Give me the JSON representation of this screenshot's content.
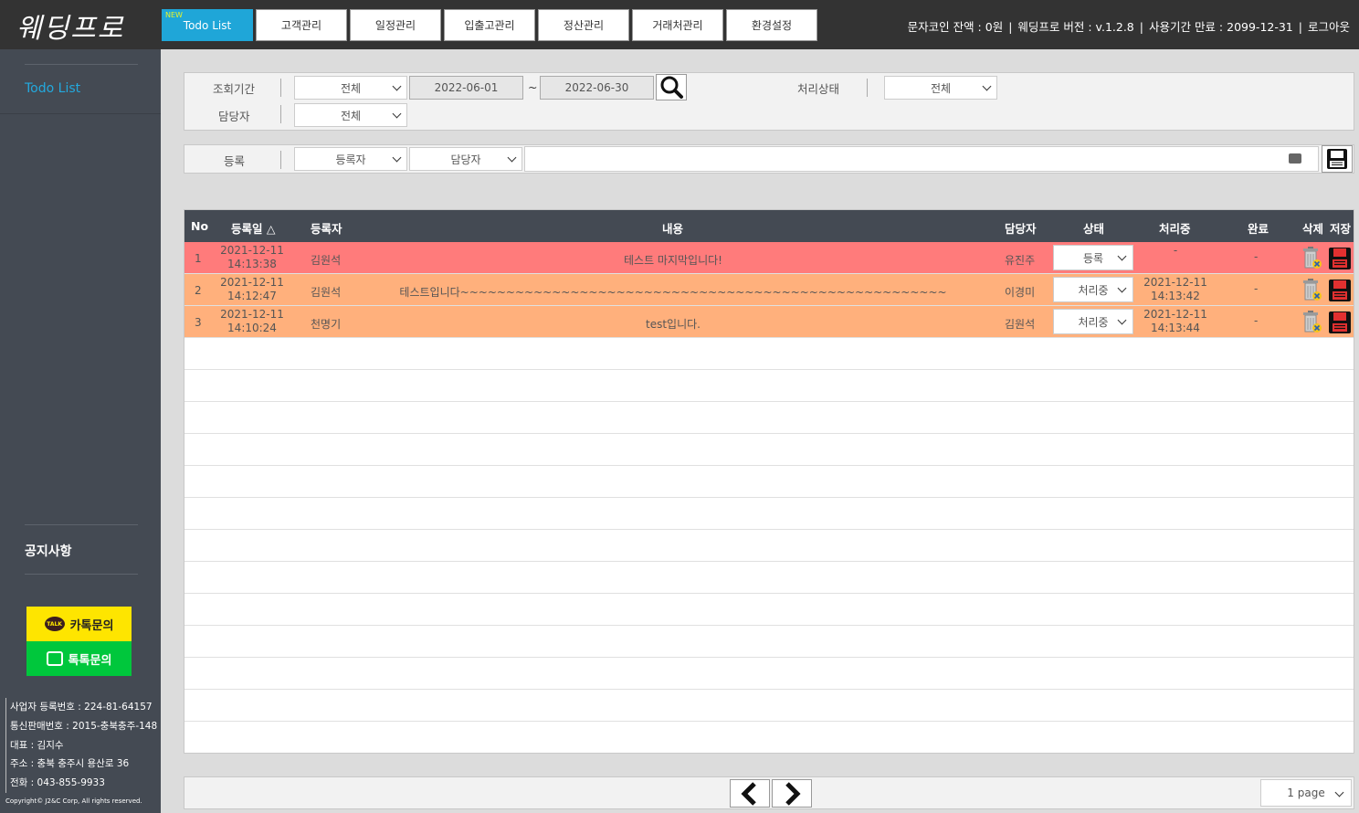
{
  "app": {
    "logo": "웨딩프로"
  },
  "nav": {
    "new_tag": "NEW",
    "tabs": [
      "Todo List",
      "고객관리",
      "일정관리",
      "입출고관리",
      "정산관리",
      "거래처관리",
      "환경설정"
    ]
  },
  "topinfo": {
    "coin": "문자코인 잔액 : 0원",
    "version": "웨딩프로 버전 : v.1.2.8",
    "expire": "사용기간 만료 : 2099-12-31",
    "logout": "로그아웃",
    "sep": "|"
  },
  "sidebar": {
    "menu": "Todo List",
    "notice": "공지사항",
    "kakao": "카톡문의",
    "kakao_badge": "TALK",
    "talktalk": "톡톡문의",
    "company": [
      "사업자 등록번호 : 224-81-64157",
      "통신판매번호 : 2015-충북충주-148",
      "대표 : 김지수",
      "주소 : 충북 충주시 용산로 36",
      "전화 : 043-855-9933"
    ],
    "copyright": "Copyright© J2&C Corp, All rights reserved."
  },
  "filter": {
    "period_label": "조회기간",
    "period_select": "전체",
    "date_from": "2022-06-01",
    "tilde": "~",
    "date_to": "2022-06-30",
    "status_label": "처리상태",
    "status_select": "전체",
    "manager_label": "담당자",
    "manager_select": "전체"
  },
  "register": {
    "label": "등록",
    "registrant_select": "등록자",
    "manager_select": "담당자",
    "content_value": ""
  },
  "table": {
    "headers": {
      "no": "No",
      "date": "등록일 △",
      "registrant": "등록자",
      "content": "내용",
      "manager": "담당자",
      "status": "상태",
      "processing": "처리중",
      "done": "완료",
      "delete": "삭제",
      "save": "저장"
    },
    "rows": [
      {
        "no": "1",
        "date": "2021-12-11",
        "time": "14:13:38",
        "registrant": "김원석",
        "content": "테스트 마지막입니다!",
        "manager": "유진주",
        "status": "등록",
        "processing_date": "-",
        "processing_time": "",
        "done": "-"
      },
      {
        "no": "2",
        "date": "2021-12-11",
        "time": "14:12:47",
        "registrant": "김원석",
        "content": "테스트입니다~~~~~~~~~~~~~~~~~~~~~~~~~~~~~~~~~~~~~~~~~~~~~~~~~~~~~",
        "manager": "이경미",
        "status": "처리중",
        "processing_date": "2021-12-11",
        "processing_time": "14:13:42",
        "done": "-"
      },
      {
        "no": "3",
        "date": "2021-12-11",
        "time": "14:10:24",
        "registrant": "천명기",
        "content": "test입니다.",
        "manager": "김원석",
        "status": "처리중",
        "processing_date": "2021-12-11",
        "processing_time": "14:13:44",
        "done": "-"
      }
    ]
  },
  "pager": {
    "page_select": "1 page"
  },
  "colors": {
    "accent": "#1fa6d8",
    "header": "#444a53",
    "row_red": "#ff7b7b",
    "row_orange": "#ffb07c",
    "kakao": "#fee500",
    "talktalk": "#00c73c"
  }
}
